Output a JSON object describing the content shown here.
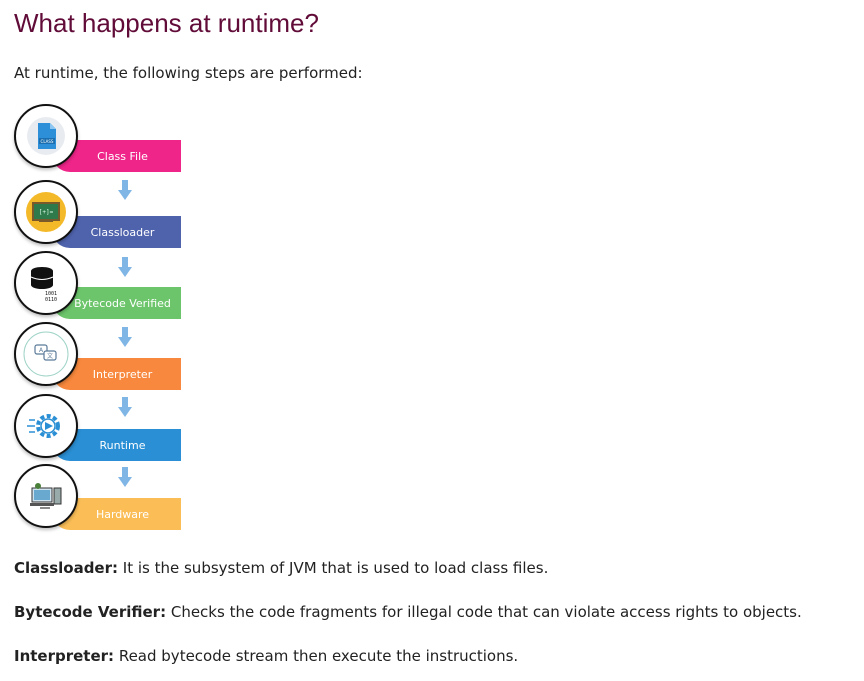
{
  "heading": "What happens at runtime?",
  "intro": "At runtime, the following steps are performed:",
  "steps": [
    {
      "label": "Class File",
      "color": "#f0258a",
      "icon": "class-file-icon",
      "icon_text": "CLASS"
    },
    {
      "label": "Classloader",
      "color": "#4f63ad",
      "icon": "classloader-icon"
    },
    {
      "label": "Bytecode Verified",
      "color": "#6cc56b",
      "icon": "bytecode-database-icon",
      "icon_text": "1001 0110"
    },
    {
      "label": "Interpreter",
      "color": "#f7883d",
      "icon": "interpreter-chat-icon"
    },
    {
      "label": "Runtime",
      "color": "#2a8fd4",
      "icon": "runtime-gear-icon"
    },
    {
      "label": "Hardware",
      "color": "#fbbe57",
      "icon": "hardware-icon"
    }
  ],
  "arrow_color": "#7fb6e6",
  "definitions": [
    {
      "term": "Classloader:",
      "text": " It is the subsystem of JVM that is used to load class files."
    },
    {
      "term": "Bytecode Verifier:",
      "text": " Checks the code fragments for illegal code that can violate access rights to objects."
    },
    {
      "term": "Interpreter:",
      "text": " Read bytecode stream then execute the instructions."
    }
  ]
}
